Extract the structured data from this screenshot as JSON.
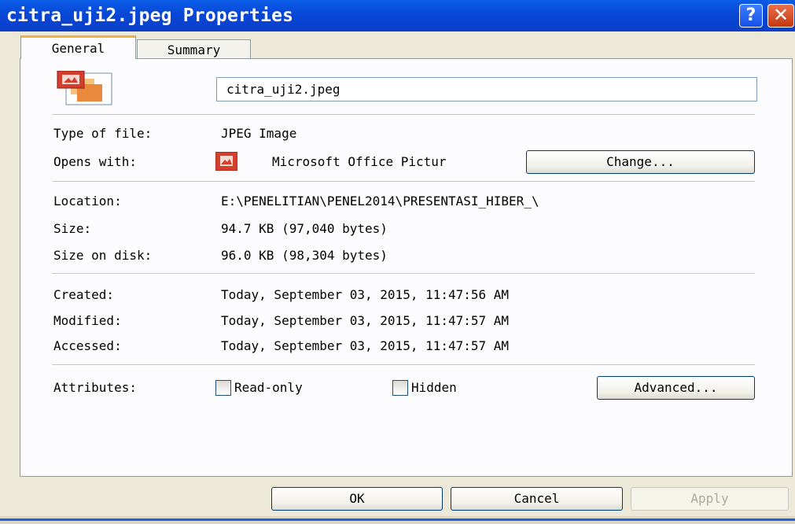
{
  "window": {
    "title": "citra_uji2.jpeg Properties",
    "help_label": "?",
    "close_label": "✕"
  },
  "tabs": [
    {
      "label": "General",
      "selected": true
    },
    {
      "label": "Summary",
      "selected": false
    }
  ],
  "general": {
    "filename": "citra_uji2.jpeg",
    "file_icon": "picture-manager-file-icon",
    "type_label": "Type of file:",
    "type_value": "JPEG Image",
    "opens_label": "Opens with:",
    "opens_icon": "picture-manager-icon",
    "opens_value": "Microsoft Office Pictur",
    "change_label": "Change...",
    "location_label": "Location:",
    "location_value": "E:\\PENELITIAN\\PENEL2014\\PRESENTASI_HIBER_\\",
    "size_label": "Size:",
    "size_value": "94.7 KB (97,040 bytes)",
    "size_disk_label": "Size on disk:",
    "size_disk_value": "96.0 KB (98,304 bytes)",
    "created_label": "Created:",
    "created_value": "Today, September 03, 2015, 11:47:56 AM",
    "modified_label": "Modified:",
    "modified_value": "Today, September 03, 2015, 11:47:57 AM",
    "accessed_label": "Accessed:",
    "accessed_value": "Today, September 03, 2015, 11:47:57 AM",
    "attributes_label": "Attributes:",
    "readonly_label": "Read-only",
    "readonly_checked": false,
    "hidden_label": "Hidden",
    "hidden_checked": false,
    "advanced_label": "Advanced..."
  },
  "buttons": {
    "ok": "OK",
    "cancel": "Cancel",
    "apply": "Apply"
  },
  "colors": {
    "titlebar": "#0a5de8",
    "dialog_bg": "#ece9d8",
    "panel_bg": "#fcfcfe",
    "tab_highlight": "#f5b23a",
    "disabled_text": "#acaa99"
  }
}
